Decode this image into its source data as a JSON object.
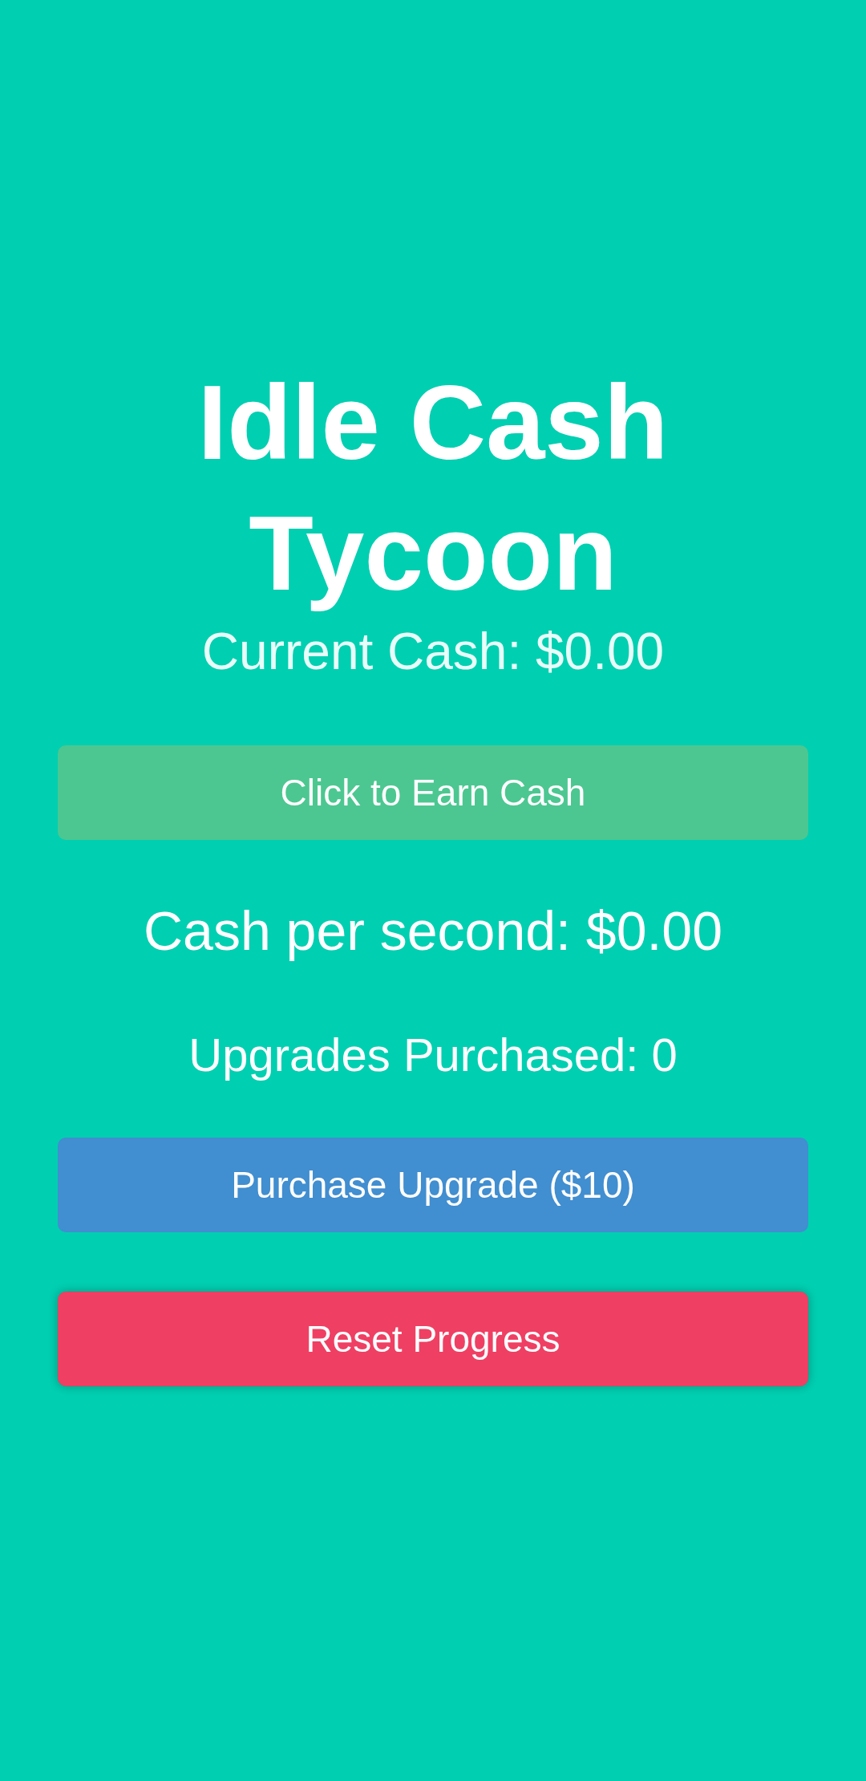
{
  "title": "Idle Cash Tycoon",
  "current_cash": "Current Cash: $0.00",
  "buttons": [
    {
      "kind": "earn",
      "label": "Click to Earn Cash"
    }
  ],
  "cash_per_second": "Cash per second: $0.00",
  "upgrades_purchased": "Upgrades Purchased: 0",
  "actions": [
    {
      "kind": "upgrade",
      "label": "Purchase Upgrade ($10)"
    },
    {
      "kind": "reset",
      "label": "Reset Progress"
    }
  ]
}
